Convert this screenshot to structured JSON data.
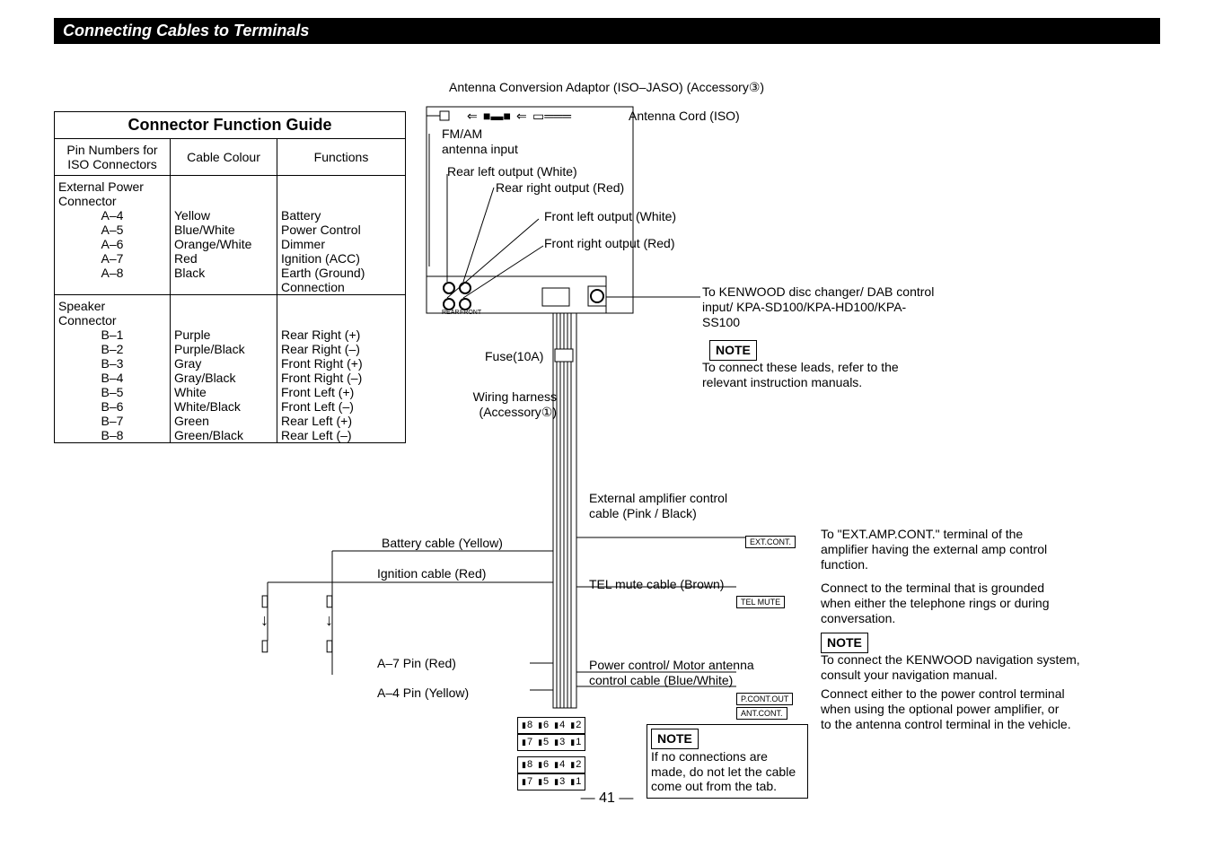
{
  "header": "Connecting Cables to Terminals",
  "guide": {
    "title": "Connector Function Guide",
    "columns": [
      "Pin Numbers for ISO Connectors",
      "Cable Colour",
      "Functions"
    ],
    "section1": {
      "label": "External Power Connector",
      "rows": [
        {
          "pin": "A–4",
          "colour": "Yellow",
          "func": "Battery"
        },
        {
          "pin": "A–5",
          "colour": "Blue/White",
          "func": "Power Control"
        },
        {
          "pin": "A–6",
          "colour": "Orange/White",
          "func": "Dimmer"
        },
        {
          "pin": "A–7",
          "colour": "Red",
          "func": "Ignition (ACC)"
        },
        {
          "pin": "A–8",
          "colour": "Black",
          "func": "Earth (Ground) Connection"
        }
      ]
    },
    "section2": {
      "label": "Speaker Connector",
      "rows": [
        {
          "pin": "B–1",
          "colour": "Purple",
          "func": "Rear Right (+)"
        },
        {
          "pin": "B–2",
          "colour": "Purple/Black",
          "func": "Rear Right (–)"
        },
        {
          "pin": "B–3",
          "colour": "Gray",
          "func": "Front Right (+)"
        },
        {
          "pin": "B–4",
          "colour": "Gray/Black",
          "func": "Front Right (–)"
        },
        {
          "pin": "B–5",
          "colour": "White",
          "func": "Front Left (+)"
        },
        {
          "pin": "B–6",
          "colour": "White/Black",
          "func": "Front Left (–)"
        },
        {
          "pin": "B–7",
          "colour": "Green",
          "func": "Rear Left (+)"
        },
        {
          "pin": "B–8",
          "colour": "Green/Black",
          "func": "Rear Left (–)"
        }
      ]
    }
  },
  "labels": {
    "antenna_adaptor": "Antenna Conversion Adaptor (ISO–JASO) (Accessory③)",
    "antenna_cord": "Antenna Cord (ISO)",
    "fmam": "FM/AM antenna input",
    "rear_left_out": "Rear left output (White)",
    "rear_right_out": "Rear right output (Red)",
    "front_left_out": "Front left output (White)",
    "front_right_out": "Front right output (Red)",
    "to_kenwood": "To KENWOOD disc changer/ DAB control input/ KPA-SD100/KPA-HD100/KPA-SS100",
    "note": "NOTE",
    "note_leads": "To connect these leads, refer to the relevant instruction manuals.",
    "fuse": "Fuse(10A)",
    "wiring": "Wiring harness (Accessory①)",
    "ext_amp": "External amplifier control cable (Pink / Black)",
    "tel_mute": "TEL mute cable (Brown)",
    "power_ctrl": "Power control/ Motor antenna control cable (Blue/White)",
    "battery_cable": "Battery cable (Yellow)",
    "ignition_cable": "Ignition cable (Red)",
    "a7pin": "A–7 Pin (Red)",
    "a4pin": "A–4 Pin (Yellow)",
    "tag_ext": "EXT.CONT.",
    "tag_tel": "TEL MUTE",
    "tag_pcont": "P.CONT.OUT",
    "tag_ant": "ANT.CONT.",
    "rear_label": "REAR",
    "front_label": "FRONT",
    "note_conn": "If no connections are made, do not let the cable come out from the tab.",
    "ext_desc": "To \"EXT.AMP.CONT.\" terminal of the amplifier having the external amp control function.",
    "tel_desc": "Connect to the terminal that is grounded when either the telephone rings or during conversation.",
    "nav_note": "To connect the KENWOOD navigation system, consult your navigation manual.",
    "pwr_desc": "Connect either to the power control terminal when using the optional power amplifier, or to the antenna control terminal in the vehicle.",
    "conn_top": [
      "8",
      "6",
      "4",
      "2"
    ],
    "conn_bot": [
      "7",
      "5",
      "3",
      "1"
    ]
  },
  "page": "— 41 —"
}
